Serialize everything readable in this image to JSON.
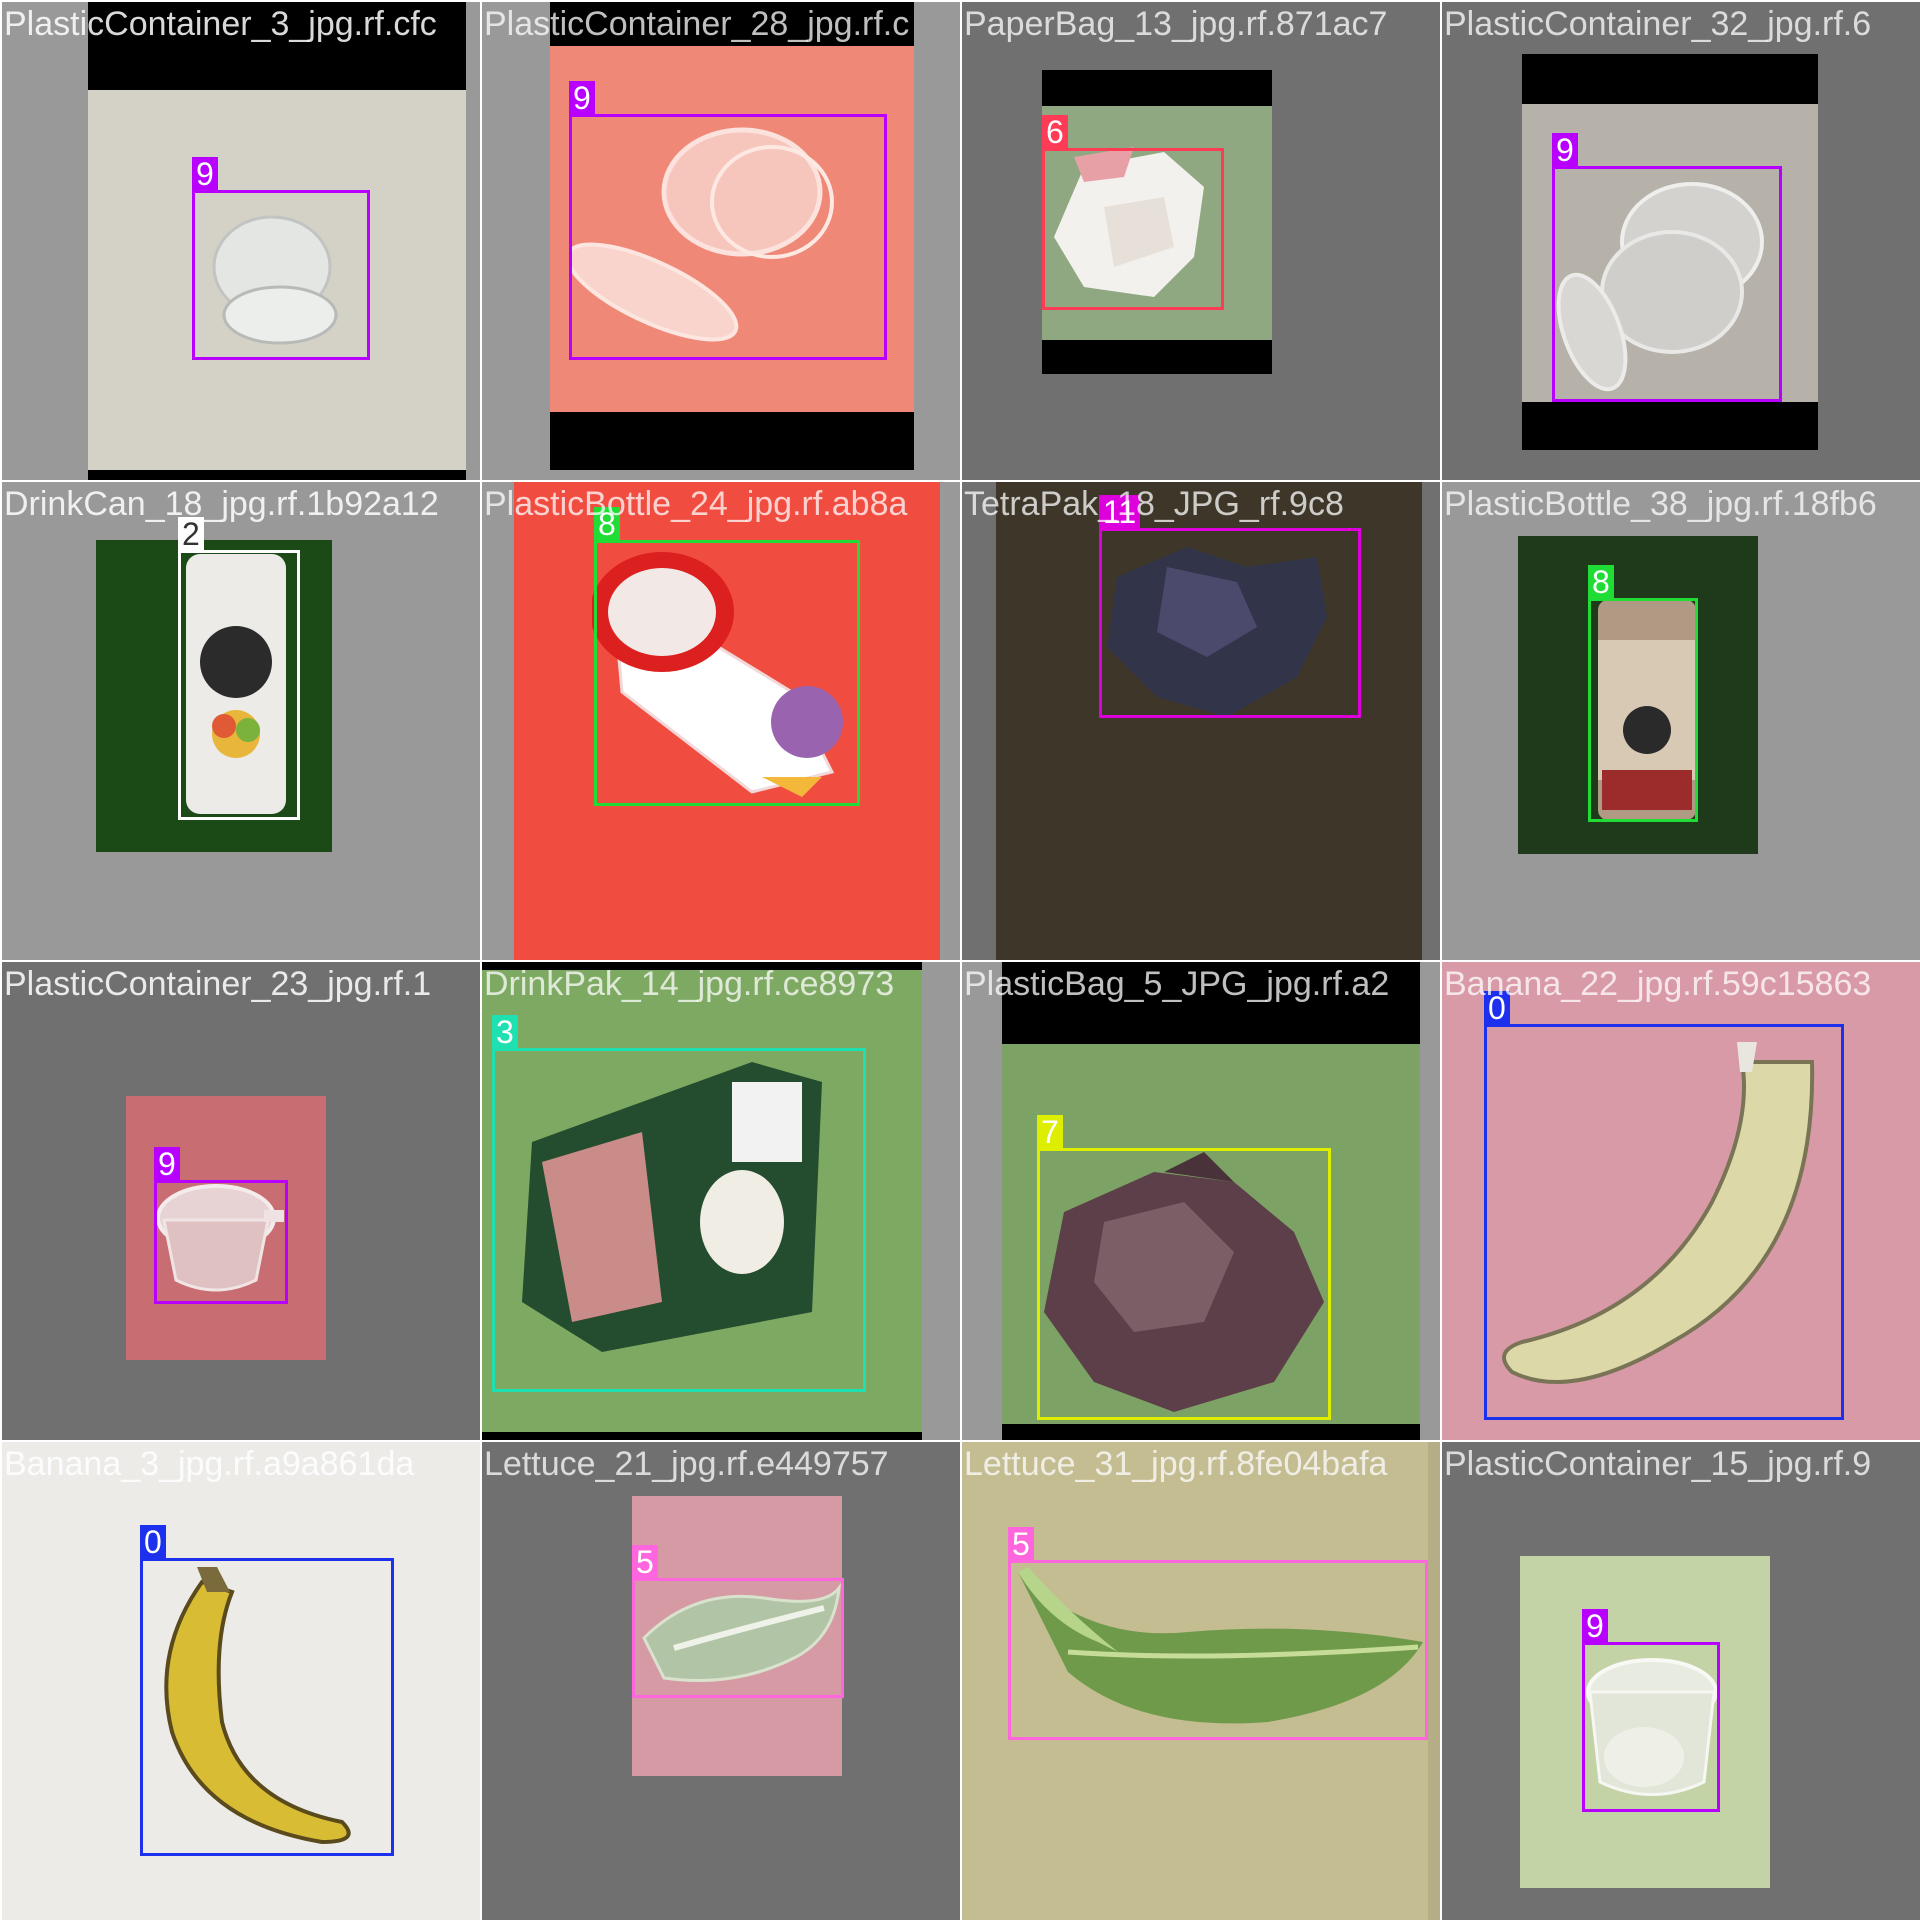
{
  "tiles": [
    {
      "filename": "PlasticContainer_3_jpg.rf.cfc",
      "overlap": "PlasticContainer_28_jpg.rf.c",
      "label": "9",
      "color": "#b700ff",
      "tile_bg": "#999999",
      "photo_bg": "#d4d2c6"
    },
    {
      "filename": "PlasticContainer_28_jpg.rf.c",
      "overlap": "PaperBag_13_jpg.rf.871ac7",
      "label": "9",
      "color": "#b700ff",
      "tile_bg": "#999999",
      "photo_bg": "#f08878"
    },
    {
      "filename": "PaperBag_13_jpg.rf.871ac7",
      "overlap": "PlasticContainer_32_jpg.rf.6",
      "label": "6",
      "color": "#ff3b55",
      "tile_bg": "#707070",
      "photo_bg": "#8fa882"
    },
    {
      "filename": "PlasticContainer_32_jpg.rf.6",
      "overlap": "",
      "label": "9",
      "color": "#b700ff",
      "tile_bg": "#707070",
      "photo_bg": "#b6b2aa"
    },
    {
      "filename": "DrinkCan_18_jpg.rf.1b92a12",
      "overlap": "PlasticBottle_24_jpg.rf.ab8a",
      "label": "2",
      "color": "#ffffff",
      "tile_bg": "#999999",
      "photo_bg": "#1c4a16"
    },
    {
      "filename": "PlasticBottle_24_jpg.rf.ab8a",
      "overlap": "TetraPak_18_JPG_rf.9c8",
      "label": "8",
      "color": "#1fdd35",
      "tile_bg": "#999999",
      "photo_bg": "#f04c40"
    },
    {
      "filename": "TetraPak_18_JPG_rf.9c8",
      "overlap": "PlasticBottle_38_jpg.rf.18fb6",
      "label": "11",
      "color": "#dd00dd",
      "tile_bg": "#707070",
      "photo_bg": "#3d3629"
    },
    {
      "filename": "PlasticBottle_38_jpg.rf.18fb6",
      "overlap": "",
      "label": "8",
      "color": "#1fdd35",
      "tile_bg": "#999999",
      "photo_bg": "#1f3a1a"
    },
    {
      "filename": "PlasticContainer_23_jpg.rf.1",
      "overlap": "DrinkPak_14_jpg.rf.ce8973",
      "label": "9",
      "color": "#b700ff",
      "tile_bg": "#707070",
      "photo_bg": "#c86e72"
    },
    {
      "filename": "DrinkPak_14_jpg.rf.ce8973",
      "overlap": "PlasticBag_5_JPG_jpg.rf.a2",
      "label": "3",
      "color": "#1fe0b0",
      "tile_bg": "#999999",
      "photo_bg": "#7ea962"
    },
    {
      "filename": "PlasticBag_5_JPG_jpg.rf.a2",
      "overlap": "Banana_22_jpg.rf.59c15863",
      "label": "7",
      "color": "#ddee00",
      "tile_bg": "#999999",
      "photo_bg": "#7da265"
    },
    {
      "filename": "Banana_22_jpg.rf.59c15863",
      "overlap": "",
      "label": "0",
      "color": "#1c30ee",
      "tile_bg": "#d7a0a8",
      "photo_bg": "#d99aa7"
    },
    {
      "filename": "Banana_3_jpg.rf.a9a861da",
      "overlap": "Lettuce_21_jpg.rf.e449757",
      "label": "0",
      "color": "#1c30ee",
      "tile_bg": "#ecebe8",
      "photo_bg": "#eceae6"
    },
    {
      "filename": "Lettuce_21_jpg.rf.e449757",
      "overlap": "Lettuce_31_jpg.rf.8fe04bafa",
      "label": "5",
      "color": "#ff66dd",
      "tile_bg": "#707070",
      "photo_bg": "#d69aa5"
    },
    {
      "filename": "Lettuce_31_jpg.rf.8fe04bafa",
      "overlap": "PlasticContainer_15_jpg.rf.9",
      "label": "5",
      "color": "#ff66dd",
      "tile_bg": "#b5ad86",
      "photo_bg": "#c4bd92"
    },
    {
      "filename": "PlasticContainer_15_jpg.rf.9",
      "overlap": "",
      "label": "9",
      "color": "#b700ff",
      "tile_bg": "#707070",
      "photo_bg": "#c3d3a6"
    }
  ]
}
